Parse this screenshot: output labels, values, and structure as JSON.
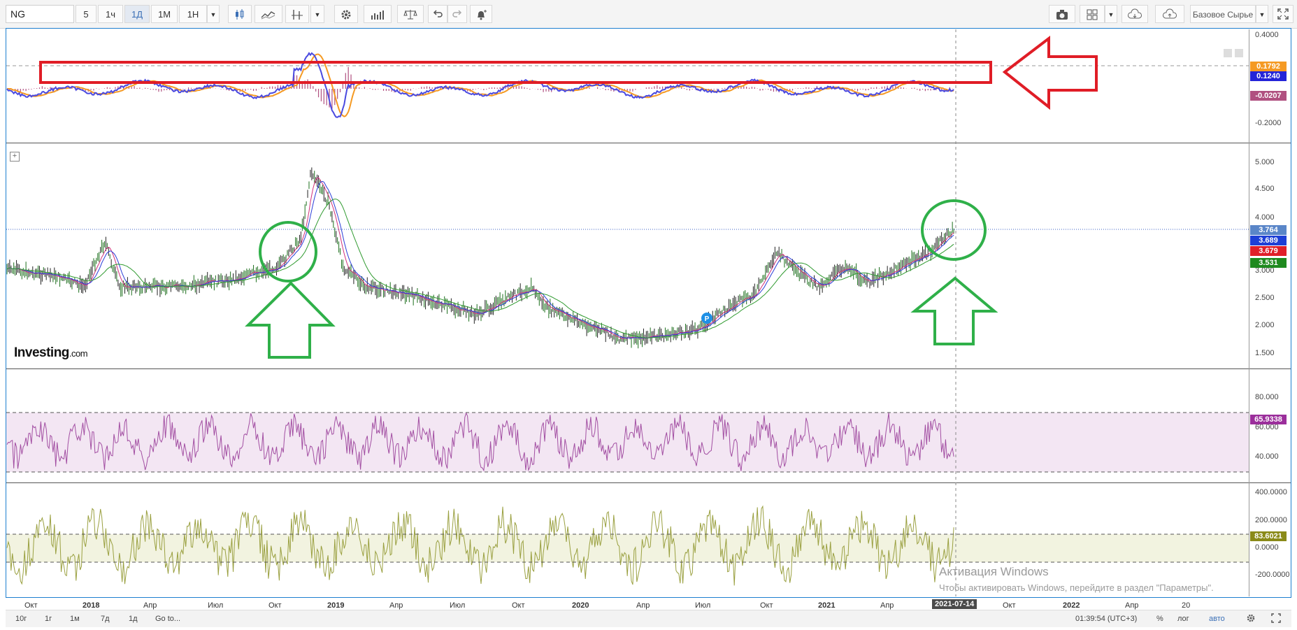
{
  "toolbar": {
    "symbol": "NG",
    "intervals": [
      "5",
      "1ч",
      "1Д",
      "1М",
      "1Н"
    ],
    "active_interval": "1Д",
    "category": "Базовое Сырье"
  },
  "panes": {
    "macd": {
      "ticks": [
        "0.4000",
        "-0.2000"
      ],
      "values": [
        "0.1792",
        "0.1240",
        "-0.0207"
      ],
      "colors": [
        "#f59a23",
        "#2424d8",
        "#b05080"
      ]
    },
    "price": {
      "ticks": [
        "5.000",
        "4.500",
        "4.000",
        "3.000",
        "2.500",
        "2.000",
        "1.500"
      ],
      "values": [
        "3.764",
        "3.689",
        "3.679",
        "3.531"
      ],
      "colors": [
        "#5a86c8",
        "#1e3fd6",
        "#e0202a",
        "#1f8a1f"
      ],
      "logo": "Investing",
      "logo_suffix": ".com",
      "marker": "P"
    },
    "rsi": {
      "ticks": [
        "80.000",
        "60.000",
        "40.000"
      ],
      "value": "65.9338",
      "color": "#9b2e9b"
    },
    "cci": {
      "ticks": [
        "400.0000",
        "200.0000",
        "0.0000",
        "-200.0000"
      ],
      "value": "83.6021",
      "color": "#8a8a18"
    }
  },
  "x_axis": {
    "labels": [
      "Окт",
      "2018",
      "Апр",
      "Июл",
      "Окт",
      "2019",
      "Апр",
      "Июл",
      "Окт",
      "2020",
      "Апр",
      "Июл",
      "Окт",
      "2021",
      "Апр",
      "Окт",
      "2022",
      "Апр",
      "20"
    ],
    "current_date": "2021-07-14"
  },
  "bottom_bar": {
    "ranges": [
      "10г",
      "1г",
      "1м",
      "7д",
      "1д",
      "Go to..."
    ],
    "time": "01:39:54 (UTC+3)",
    "percent": "%",
    "log": "лог",
    "auto": "авто"
  },
  "watermark": {
    "title": "Активация Windows",
    "subtitle": "Чтобы активировать Windows, перейдите в раздел \"Параметры\"."
  }
}
